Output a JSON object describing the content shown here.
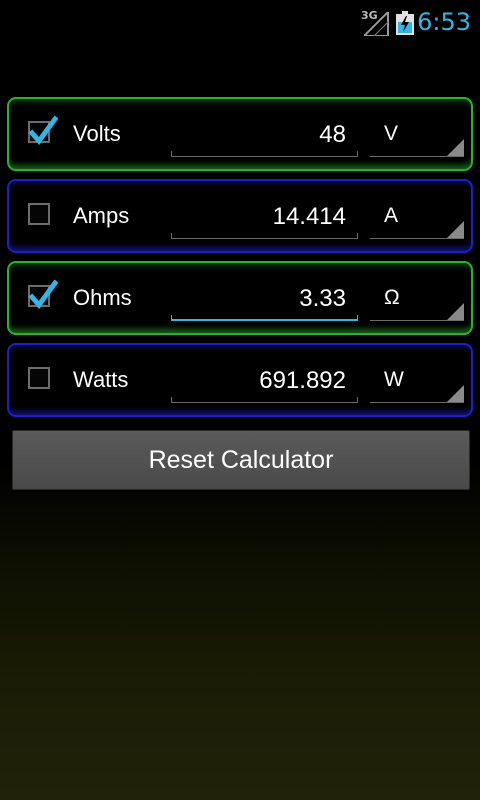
{
  "status_bar": {
    "network_type": "3G",
    "time": "6:53"
  },
  "rows": [
    {
      "label": "Volts",
      "value": "48",
      "unit": "V",
      "checked": true
    },
    {
      "label": "Amps",
      "value": "14.414",
      "unit": "A",
      "checked": false
    },
    {
      "label": "Ohms",
      "value": "3.33",
      "unit": "Ω",
      "checked": true,
      "focused": true
    },
    {
      "label": "Watts",
      "value": "691.892",
      "unit": "W",
      "checked": false
    }
  ],
  "reset_button": {
    "label": "Reset Calculator"
  },
  "colors": {
    "checked_border": "#29b22c",
    "unchecked_border": "#1f1fc8",
    "accent": "#33b5e5",
    "checkmark": "#33b5e5"
  }
}
